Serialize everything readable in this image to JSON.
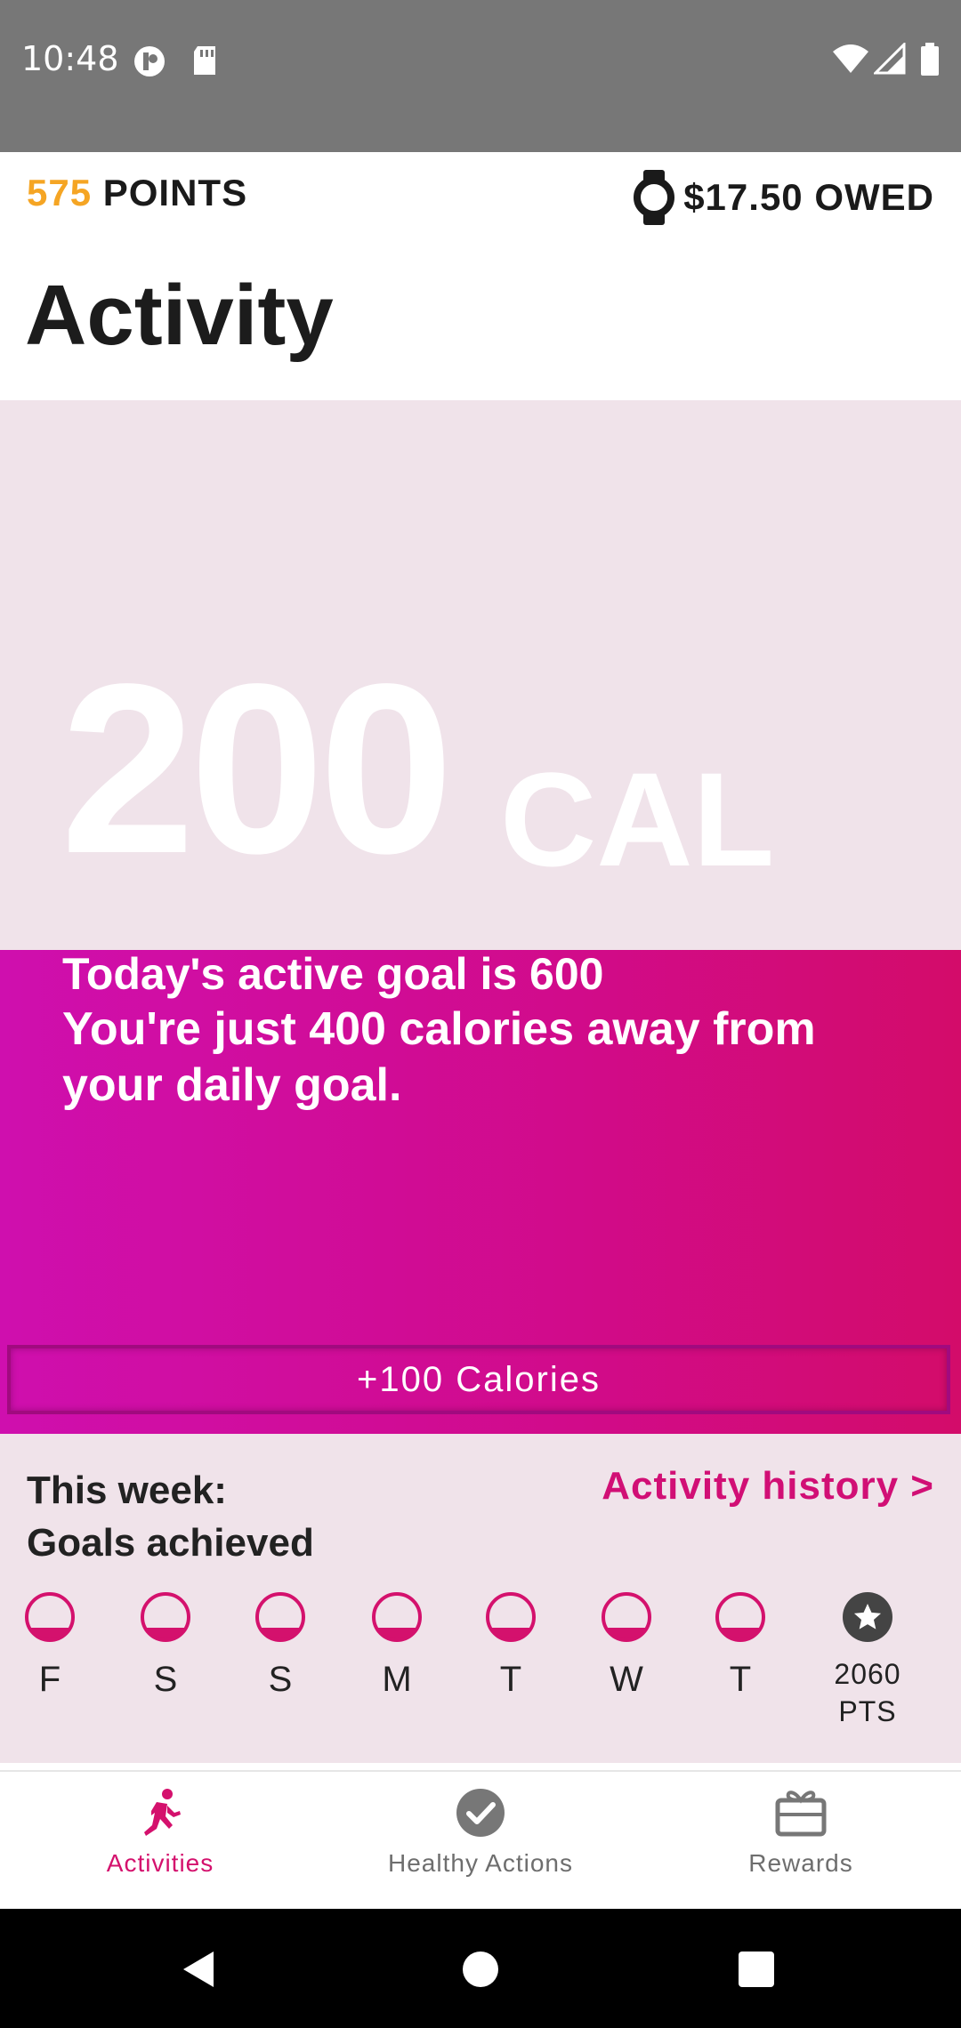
{
  "status_bar": {
    "time": "10:48"
  },
  "header": {
    "points_value": "575",
    "points_label": "POINTS",
    "owed": "$17.50 OWED",
    "page_title": "Activity"
  },
  "calories": {
    "value": "200",
    "unit": "CAL"
  },
  "goal": {
    "line1": "Today's active goal is 600",
    "line2": "You're just 400 calories away from your daily goal.",
    "add_button": "+100 Calories"
  },
  "week": {
    "label_line1": "This week:",
    "label_line2": "Goals achieved",
    "history_link": "Activity history >",
    "days": [
      "F",
      "S",
      "S",
      "M",
      "T",
      "W",
      "T"
    ],
    "days_progress": [
      0.25,
      0.25,
      0.25,
      0.25,
      0.25,
      0.25,
      0.25
    ],
    "points_value": "2060",
    "points_unit": "PTS"
  },
  "bottom_nav": {
    "items": [
      {
        "label": "Activities",
        "icon": "running-person-icon",
        "active": true
      },
      {
        "label": "Healthy Actions",
        "icon": "check-circle-icon",
        "active": false
      },
      {
        "label": "Rewards",
        "icon": "gift-icon",
        "active": false
      }
    ]
  },
  "colors": {
    "accent": "#d4116d",
    "points": "#f5a524",
    "gradient_start": "#cf0fae",
    "gradient_end": "#d30c6a",
    "panel_bg": "#f0e3ea"
  }
}
